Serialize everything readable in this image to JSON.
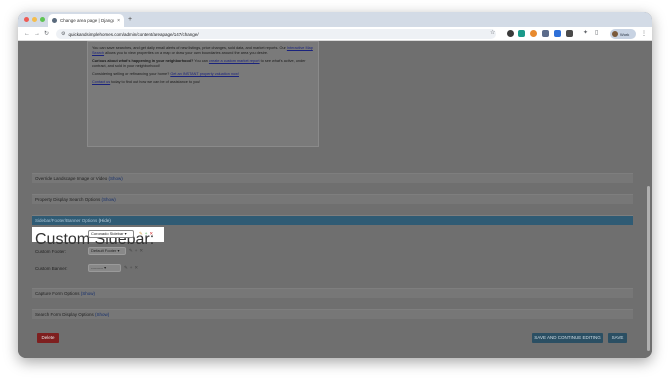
{
  "browser": {
    "tab_title": "Change area page | Django s",
    "tab_close": "×",
    "new_tab": "+",
    "back": "←",
    "forward": "→",
    "reload": "↻",
    "url": "quickandsimplehomes.com/admin/content/areapage/147/change/",
    "profile_name": "Work",
    "menu": "⋮",
    "icons": [
      "back-icon",
      "forward-icon",
      "reload-icon",
      "site-info-icon",
      "bookmark-star-icon",
      "extension-icons",
      "profile-avatar",
      "menu-icon"
    ]
  },
  "editor": {
    "paragraphs": [
      {
        "text": "You can save searches, and get daily email alerts of new listings, price changes, sold data, and market reports. Our ",
        "link": "Interactive Map Search",
        "after": " allows you to view properties on a map or draw your own boundaries around the area you desire."
      },
      {
        "bold": "Curious about what's happening in your neighborhood?",
        "text": " You can ",
        "link": "create a custom market report",
        "after": " to see what's active, under contract, and sold in your neighborhood!"
      },
      {
        "text": "Considering selling or refinancing your home? ",
        "link": "Get an INSTANT property valuation now!",
        "after": ""
      },
      {
        "text": "",
        "link": "Contact us",
        "after": " today to find out how we can be of assistance to you!"
      }
    ]
  },
  "sections": {
    "override_landscape": {
      "label": "Override Landscape Image or Video",
      "toggle": "(Show)"
    },
    "property_display": {
      "label": "Property Display Search Options",
      "toggle": "(Show)"
    },
    "sidebar_footer_banner": {
      "label": "Sidebar/Footer/Banner Options",
      "toggle": "(Hide)"
    },
    "capture_form": {
      "label": "Capture Form Options",
      "toggle": "(Show)"
    },
    "search_form_display": {
      "label": "Search Form Display Options",
      "toggle": "(Show)"
    }
  },
  "fields": {
    "custom_sidebar": {
      "label": "Custom Sidebar:",
      "value": "Coronado Sidebar"
    },
    "custom_footer": {
      "label": "Custom Footer:",
      "value": "Default Footer"
    },
    "custom_banner": {
      "label": "Custom Banner:",
      "value": "---------"
    }
  },
  "actions": {
    "delete": "Delete",
    "save_continue": "SAVE AND CONTINUE EDITING",
    "save": "SAVE"
  },
  "colors": {
    "section_active": "#2f5b74",
    "delete": "#7e1f1f",
    "save": "#2b4f63"
  }
}
